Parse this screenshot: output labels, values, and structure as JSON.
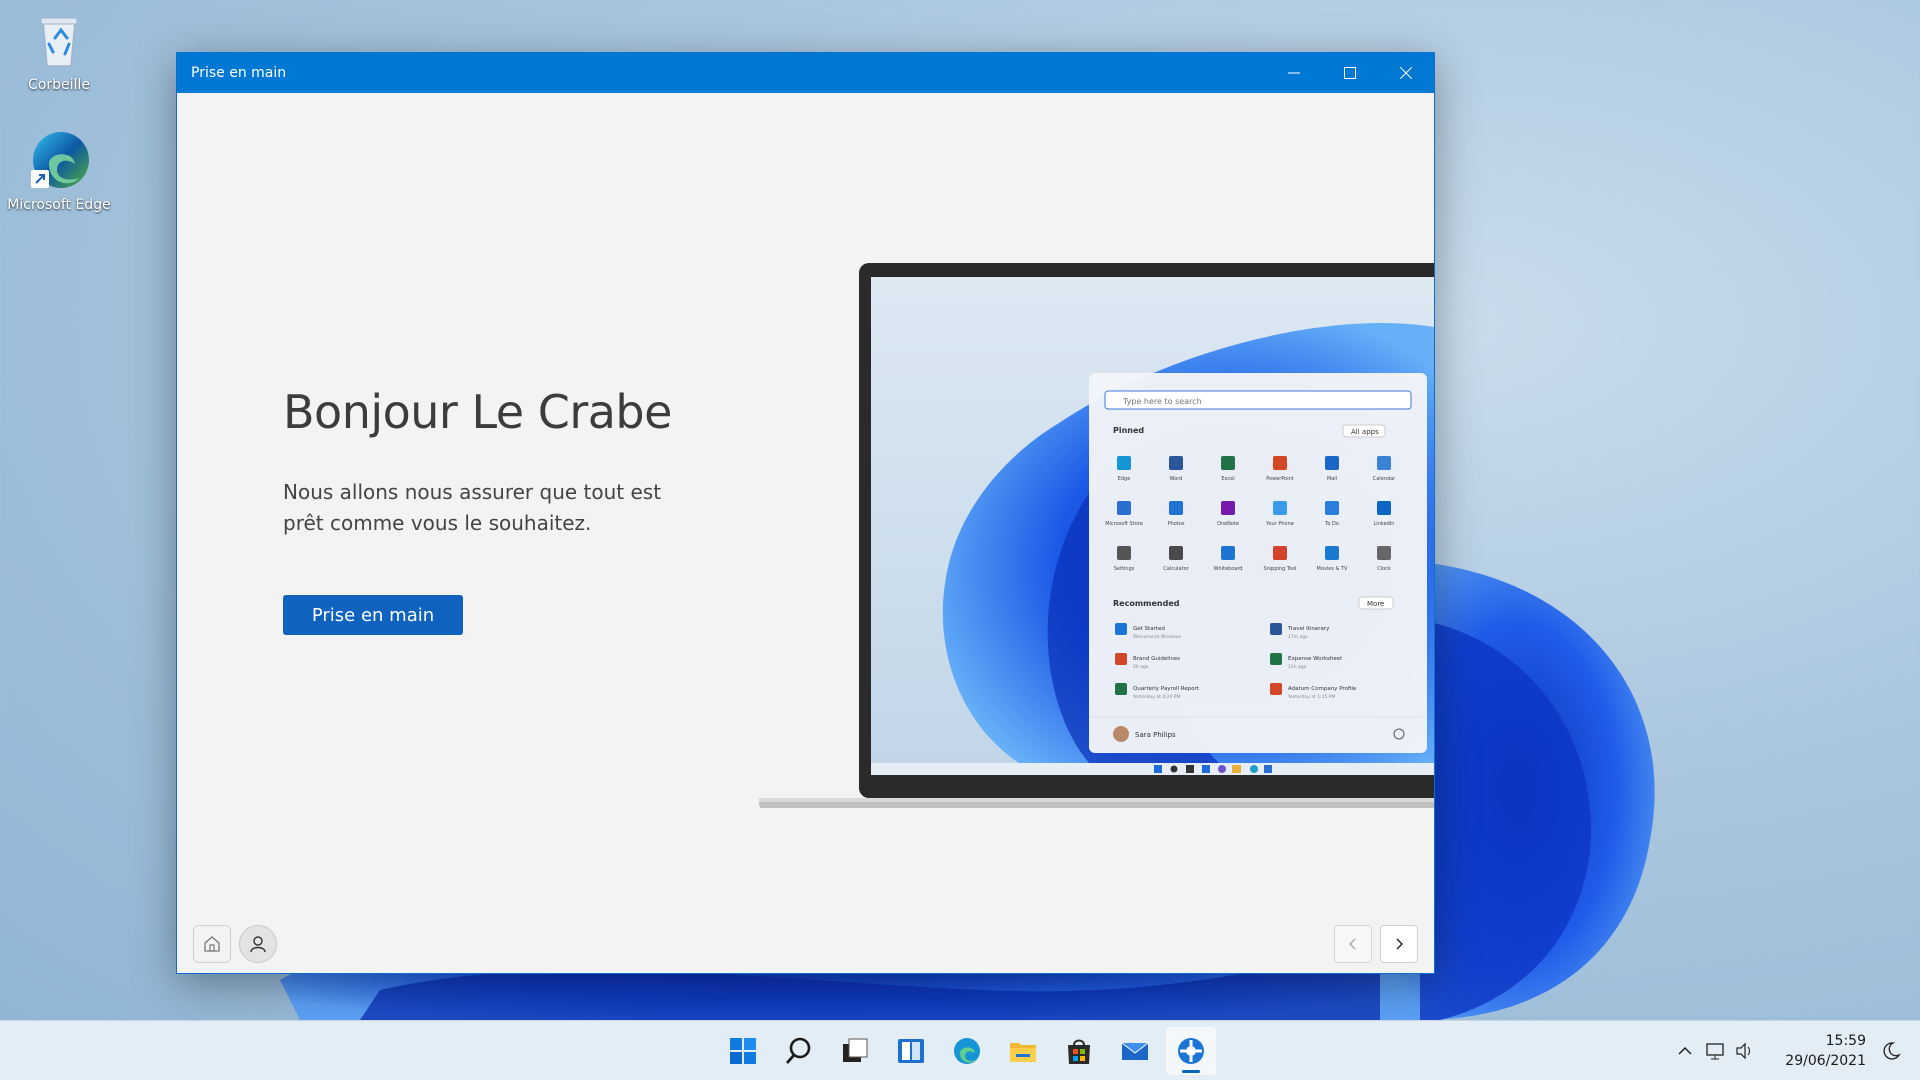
{
  "desktop": {
    "icons": [
      {
        "label": "Corbeille",
        "icon": "recycle-bin-icon"
      },
      {
        "label": "Microsoft Edge",
        "icon": "edge-icon"
      }
    ]
  },
  "window": {
    "title": "Prise en main",
    "controls": {
      "minimize": "minimize-icon",
      "maximize": "maximize-icon",
      "close": "close-icon"
    }
  },
  "main": {
    "greeting": "Bonjour Le Crabe",
    "subtitle": "Nous allons nous assurer que tout est prêt comme vous le souhaitez.",
    "cta_label": "Prise en main"
  },
  "start_menu_preview": {
    "search_placeholder": "Type here to search",
    "pinned_label": "Pinned",
    "all_apps_label": "All apps",
    "pinned_apps": [
      "Edge",
      "Word",
      "Excel",
      "PowerPoint",
      "Mail",
      "Calendar",
      "Microsoft Store",
      "Photos",
      "OneNote",
      "Your Phone",
      "To Do",
      "LinkedIn",
      "Settings",
      "Calculator",
      "Whiteboard",
      "Snipping Tool",
      "Movies & TV",
      "Clock"
    ],
    "recommended_label": "Recommended",
    "more_label": "More",
    "recommended": [
      {
        "title": "Get Started",
        "subtitle": "Welcome to Windows"
      },
      {
        "title": "Travel Itinerary",
        "subtitle": "17m ago"
      },
      {
        "title": "Brand Guidelines",
        "subtitle": "2h ago"
      },
      {
        "title": "Expense Worksheet",
        "subtitle": "12h ago"
      },
      {
        "title": "Quarterly Payroll Report",
        "subtitle": "Yesterday at 4:24 PM"
      },
      {
        "title": "Adatum Company Profile",
        "subtitle": "Yesterday at 1:15 PM"
      }
    ],
    "user_name": "Sara Philips"
  },
  "footer": {
    "home": "home-icon",
    "user": "user-icon",
    "prev": "chevron-left-icon",
    "next": "chevron-right-icon"
  },
  "taskbar": {
    "items": [
      "start-icon",
      "search-icon",
      "task-view-icon",
      "widgets-icon",
      "edge-icon",
      "file-explorer-icon",
      "store-icon",
      "mail-icon",
      "get-started-icon"
    ],
    "tray": [
      "chevron-up-icon",
      "network-icon",
      "volume-icon"
    ],
    "time": "15:59",
    "date": "29/06/2021",
    "focus": "focus-assist-icon"
  },
  "colors": {
    "accent": "#0078d4",
    "cta": "#0f62be",
    "bloom": "#1a56e0"
  }
}
